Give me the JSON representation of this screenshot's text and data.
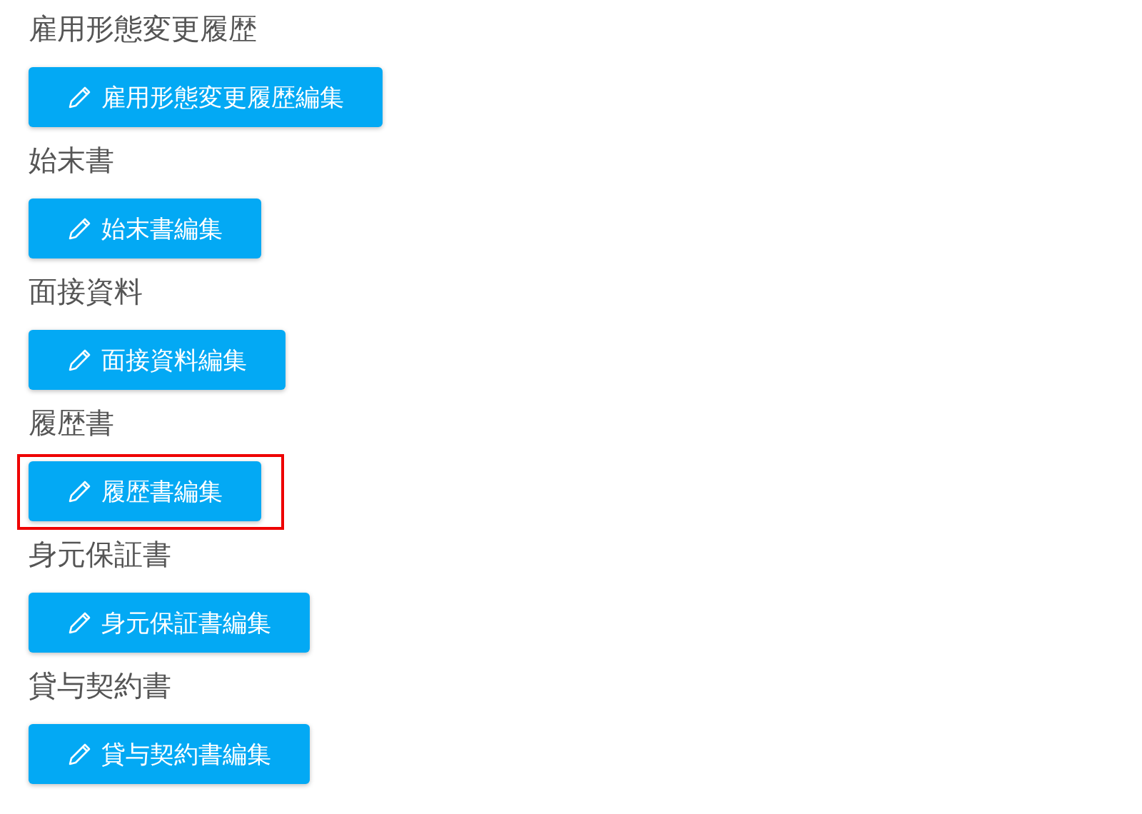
{
  "sections": [
    {
      "heading": "雇用形態変更履歴",
      "button": {
        "label": "雇用形態変更履歴編集",
        "highlighted": false
      }
    },
    {
      "heading": "始末書",
      "button": {
        "label": "始末書編集",
        "highlighted": false
      }
    },
    {
      "heading": "面接資料",
      "button": {
        "label": "面接資料編集",
        "highlighted": false
      }
    },
    {
      "heading": "履歴書",
      "button": {
        "label": "履歴書編集",
        "highlighted": true
      }
    },
    {
      "heading": "身元保証書",
      "button": {
        "label": "身元保証書編集",
        "highlighted": false
      }
    },
    {
      "heading": "貸与契約書",
      "button": {
        "label": "貸与契約書編集",
        "highlighted": false
      }
    }
  ]
}
